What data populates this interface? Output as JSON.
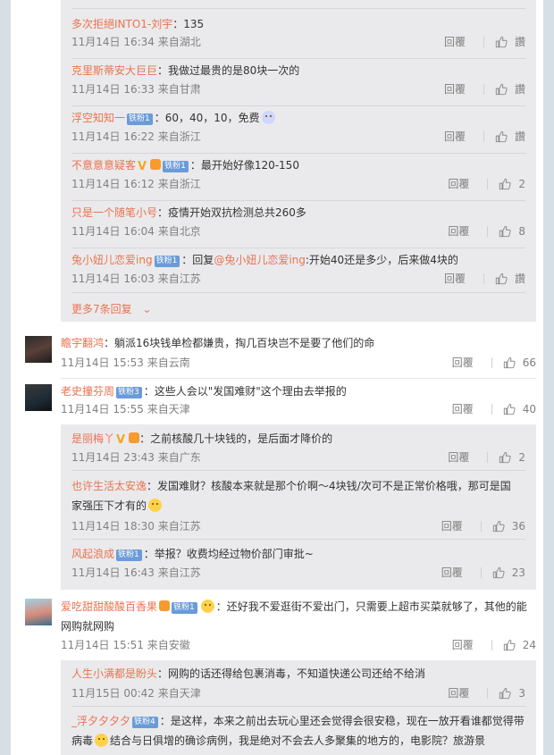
{
  "labels": {
    "reply": "回覆",
    "like": "讚",
    "more_replies": "更多7条回复"
  },
  "sub_replies_1": [
    {
      "name": "多次拒絕INTO1-刘宇",
      "text": "：135",
      "time": "11月14日 16:34 来自湖北",
      "likes": "讚"
    },
    {
      "name": "克里斯蒂安大巨巨",
      "text": "：我做过最贵的是80块一次的",
      "time": "11月14日 16:33 来自甘肃",
      "likes": "讚"
    },
    {
      "name": "浮空知知一",
      "badge": "铁粉1",
      "text": "：60，40，10，免费",
      "emoji": "smirk-emoji",
      "time": "11月14日 16:22 来自浙江",
      "likes": "讚"
    },
    {
      "name": "不意意意疑客",
      "vip": "V",
      "badge": "铁粉1",
      "text": "：最开始好像120-150",
      "time": "11月14日 16:12 来自浙江",
      "likes": "2"
    },
    {
      "name": "只是一个随笔小号",
      "text": "：疫情开始双抗检测总共260多",
      "time": "11月14日 16:04 来自北京",
      "likes": "8"
    },
    {
      "name": "兔小妞儿恋爱ing",
      "badge": "铁粉1",
      "text_pre": "：回复",
      "mention": "@兔小妞儿恋爱ing",
      "text": ":开始40还是多少，后来做4块的",
      "time": "11月14日 16:03 来自江苏",
      "likes": "讚"
    }
  ],
  "top_1": {
    "name": "瞻宇翻鸿",
    "text": "：躺派16块钱单检都嫌贵，掏几百块岂不是要了他们的命",
    "time": "11月14日 15:53 来自云南",
    "likes": "66"
  },
  "top_2": {
    "name": "老史撞芬周",
    "badge": "铁粉3",
    "text": "：这些人会以\"发国难财\"这个理由去举报的",
    "time": "11月14日 15:55 来自天津",
    "likes": "40"
  },
  "sub_replies_2": [
    {
      "name": "是丽梅丫",
      "vip": "V",
      "text": "：之前核酸几十块钱的，是后面才降价的",
      "time": "11月14日 23:43 来自广东",
      "likes": "2"
    },
    {
      "name": "也许生活太安逸",
      "text": "：发国难财？核酸本来就是那个价啊～4块钱/次可不是正常价格哦，那可是国家强压下才有的",
      "time": "11月14日 18:30 来自江苏",
      "likes": "36"
    },
    {
      "name": "风起浪成",
      "badge": "铁粉1",
      "text": "：举报？收费均经过物价部门审批~",
      "time": "11月14日 16:43 来自江苏",
      "likes": "23"
    }
  ],
  "top_3": {
    "name": "爱吃甜甜酸酸百香果",
    "badge": "铁粉1",
    "text": "：还好我不爱逛街不爱出门，只需要上超市买菜就够了，其他的能网购就网购",
    "time": "11月14日 15:51 来自安徽",
    "likes": "24"
  },
  "sub_replies_3": [
    {
      "name": "人生小满都是盼头",
      "text": "：网购的话还得给包裹消毒，不知道快递公司还给不给消",
      "time": "11月15日 00:42 来自天津",
      "likes": "3"
    },
    {
      "name": "_浮夕夕夕夕",
      "badge": "铁粉4",
      "text": "：是这样，本来之前出去玩心里还会觉得会很安稳，现在一放开看谁都觉得带病毒",
      "text2": "结合与日俱增的确诊病例，我是绝对不会去人多聚集的地方的，电影院？旅游景"
    }
  ]
}
